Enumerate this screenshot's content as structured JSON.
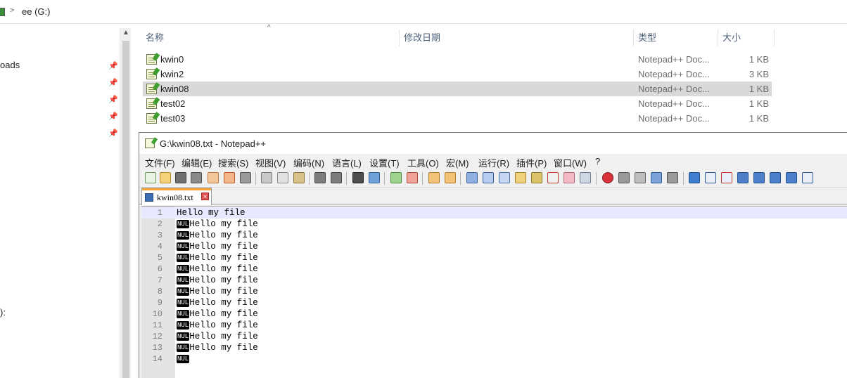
{
  "explorer": {
    "breadcrumb": "ee (G:)",
    "breadcrumb_separator": ">",
    "nav_items": [
      {
        "label": "oads"
      },
      {
        "label": "):"
      }
    ],
    "columns": {
      "name": "名称",
      "modified": "修改日期",
      "type": "类型",
      "size": "大小"
    },
    "files": [
      {
        "name": "kwin0",
        "type": "Notepad++ Doc...",
        "size": "1 KB",
        "selected": false
      },
      {
        "name": "kwin2",
        "type": "Notepad++ Doc...",
        "size": "3 KB",
        "selected": false
      },
      {
        "name": "kwin08",
        "type": "Notepad++ Doc...",
        "size": "1 KB",
        "selected": true
      },
      {
        "name": "test02",
        "type": "Notepad++ Doc...",
        "size": "1 KB",
        "selected": false
      },
      {
        "name": "test03",
        "type": "Notepad++ Doc...",
        "size": "1 KB",
        "selected": false
      }
    ]
  },
  "notepad": {
    "title": "G:\\kwin08.txt - Notepad++",
    "menu": [
      "文件(F)",
      "编辑(E)",
      "搜索(S)",
      "视图(V)",
      "编码(N)",
      "语言(L)",
      "设置(T)",
      "工具(O)",
      "宏(M)",
      "运行(R)",
      "插件(P)",
      "窗口(W)",
      "?"
    ],
    "tab_label": "kwin08.txt",
    "nul_label": "NUL",
    "lines": [
      {
        "num": "1",
        "nul": false,
        "text": "Hello my file"
      },
      {
        "num": "2",
        "nul": true,
        "text": "Hello my file"
      },
      {
        "num": "3",
        "nul": true,
        "text": "Hello my file"
      },
      {
        "num": "4",
        "nul": true,
        "text": "Hello my file"
      },
      {
        "num": "5",
        "nul": true,
        "text": "Hello my file"
      },
      {
        "num": "6",
        "nul": true,
        "text": "Hello my file"
      },
      {
        "num": "7",
        "nul": true,
        "text": "Hello my file"
      },
      {
        "num": "8",
        "nul": true,
        "text": "Hello my file"
      },
      {
        "num": "9",
        "nul": true,
        "text": "Hello my file"
      },
      {
        "num": "10",
        "nul": true,
        "text": "Hello my file"
      },
      {
        "num": "11",
        "nul": true,
        "text": "Hello my file"
      },
      {
        "num": "12",
        "nul": true,
        "text": "Hello my file"
      },
      {
        "num": "13",
        "nul": true,
        "text": "Hello my file"
      },
      {
        "num": "14",
        "nul": true,
        "text": ""
      }
    ],
    "toolbar_icons": [
      "new-file-icon",
      "open-file-icon",
      "save-icon",
      "save-all-icon",
      "close-icon",
      "close-all-icon",
      "print-icon",
      "cut-icon",
      "copy-icon",
      "paste-icon",
      "undo-icon",
      "redo-icon",
      "find-icon",
      "replace-icon",
      "zoom-in-icon",
      "zoom-out-icon",
      "sync-vertical-icon",
      "sync-horizontal-icon",
      "word-wrap-icon",
      "show-all-chars-icon",
      "indent-guide-icon",
      "user-lang-icon",
      "doc-map-icon",
      "function-list-icon",
      "folder-workspace-icon",
      "monitoring-icon",
      "record-macro-icon",
      "stop-record-icon",
      "play-macro-icon",
      "run-macro-multiple-icon",
      "save-macro-icon",
      "bookmark-icon",
      "mark-all-icon",
      "clear-marks-icon",
      "collapse-icon",
      "prev-icon",
      "next-icon",
      "expand-icon",
      "panel-icon"
    ]
  }
}
